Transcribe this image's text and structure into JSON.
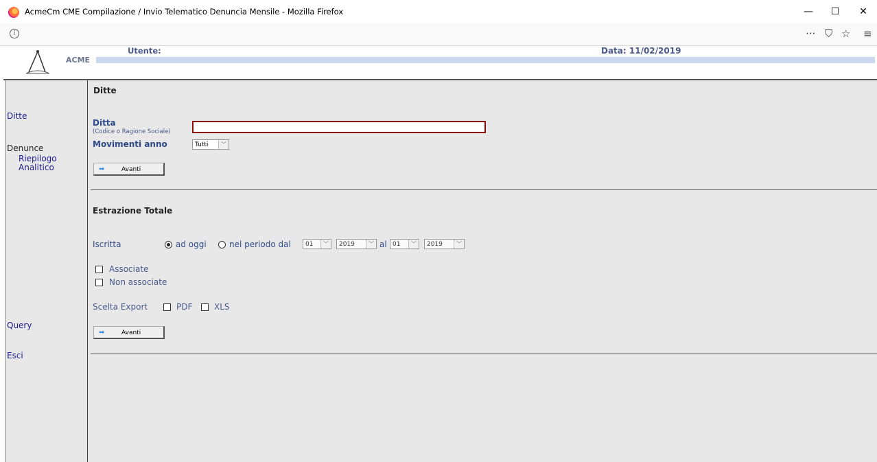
{
  "window": {
    "title": "AcmeCm CME Compilazione / Invio Telematico Denuncia Mensile - Mozilla Firefox",
    "minimize": "—",
    "maximize": "☐",
    "close": "✕"
  },
  "navbar": {
    "info_icon": "i",
    "more": "···",
    "pocket": "⛉",
    "star": "☆",
    "menu": "≡"
  },
  "header": {
    "brand": "ACME",
    "user_label": "Utente:",
    "date_label": "Data: 11/02/2019"
  },
  "sidebar": {
    "ditte": "Ditte",
    "denunce": "Denunce",
    "riepilogo": "Riepilogo",
    "analitico": "Analitico",
    "query": "Query",
    "esci": "Esci"
  },
  "ditte_section": {
    "title": "Ditte",
    "ditta_label": "Ditta",
    "ditta_hint": "(Codice o Ragione Sociale)",
    "ditta_value": "",
    "movimenti_label": "Movimenti anno",
    "movimenti_value": "Tutti",
    "avanti": "Avanti"
  },
  "estrazione_section": {
    "title": "Estrazione Totale",
    "iscritta_label": "Iscritta",
    "ad_oggi": "ad oggi",
    "nel_periodo": "nel periodo dal",
    "from_month": "01",
    "from_year": "2019",
    "al": "al",
    "to_month": "01",
    "to_year": "2019",
    "associate": "Associate",
    "non_associate": "Non associate",
    "scelta_export": "Scelta Export",
    "pdf": "PDF",
    "xls": "XLS",
    "avanti": "Avanti"
  },
  "icons": {
    "arrow": "➡",
    "chevron": "﹀"
  }
}
